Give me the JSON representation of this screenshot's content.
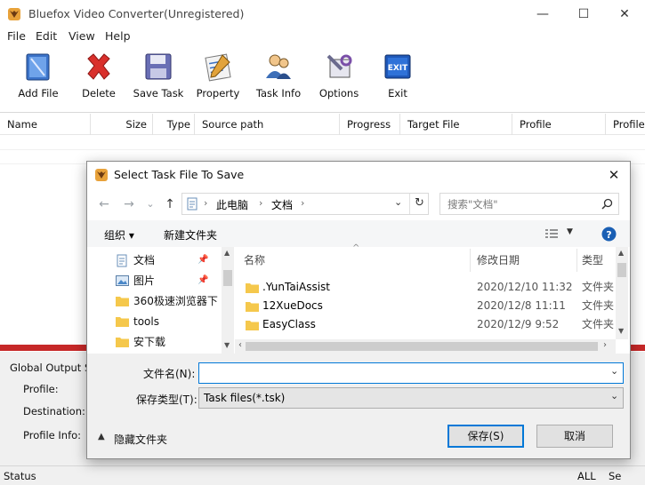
{
  "window": {
    "title": "Bluefox Video Converter(Unregistered)"
  },
  "window_controls": {
    "minimize": "—",
    "maximize": "☐",
    "close": "✕"
  },
  "menu": {
    "items": [
      "File",
      "Edit",
      "View",
      "Help"
    ]
  },
  "toolbar": {
    "add_file": "Add File",
    "delete": "Delete",
    "save_task": "Save Task",
    "property": "Property",
    "task_info": "Task Info",
    "options": "Options",
    "exit": "Exit"
  },
  "list": {
    "columns": [
      "Name",
      "Size",
      "Type",
      "Source path",
      "Progress",
      "Target File",
      "Profile",
      "Profile I"
    ]
  },
  "global_output": {
    "heading": "Global Output Setti",
    "profile_label": "Profile:",
    "destination_label": "Destination:",
    "profile_info_label": "Profile Info:"
  },
  "status": {
    "label": "Status",
    "all": "ALL",
    "se": "Se"
  },
  "dialog": {
    "title": "Select Task File To Save",
    "close": "✕",
    "nav": {
      "back": "←",
      "forward": "→",
      "dropdown": "⌄",
      "up": "↑"
    },
    "breadcrumb": [
      "此电脑",
      "文档"
    ],
    "refresh": "↻",
    "search_placeholder": "搜索\"文档\"",
    "organize": "组织 ▾",
    "new_folder": "新建文件夹",
    "help": "?",
    "tree": [
      {
        "label": "文档",
        "pinned": true
      },
      {
        "label": "图片",
        "pinned": true
      },
      {
        "label": "360极速浏览器下"
      },
      {
        "label": "tools"
      },
      {
        "label": "安下载"
      }
    ],
    "file_columns": {
      "name": "名称",
      "date": "修改日期",
      "type": "类型"
    },
    "files": [
      {
        "name": ".YunTaiAssist",
        "date": "2020/12/10 11:32",
        "type": "文件夹"
      },
      {
        "name": "12XueDocs",
        "date": "2020/12/8 11:11",
        "type": "文件夹"
      },
      {
        "name": "EasyClass",
        "date": "2020/12/9 9:52",
        "type": "文件夹"
      }
    ],
    "filename_label": "文件名(N):",
    "filename_value": "",
    "filetype_label": "保存类型(T):",
    "filetype_value": "Task files(*.tsk)",
    "hide_folders": "隐藏文件夹",
    "save_button": "保存(S)",
    "cancel_button": "取消"
  }
}
